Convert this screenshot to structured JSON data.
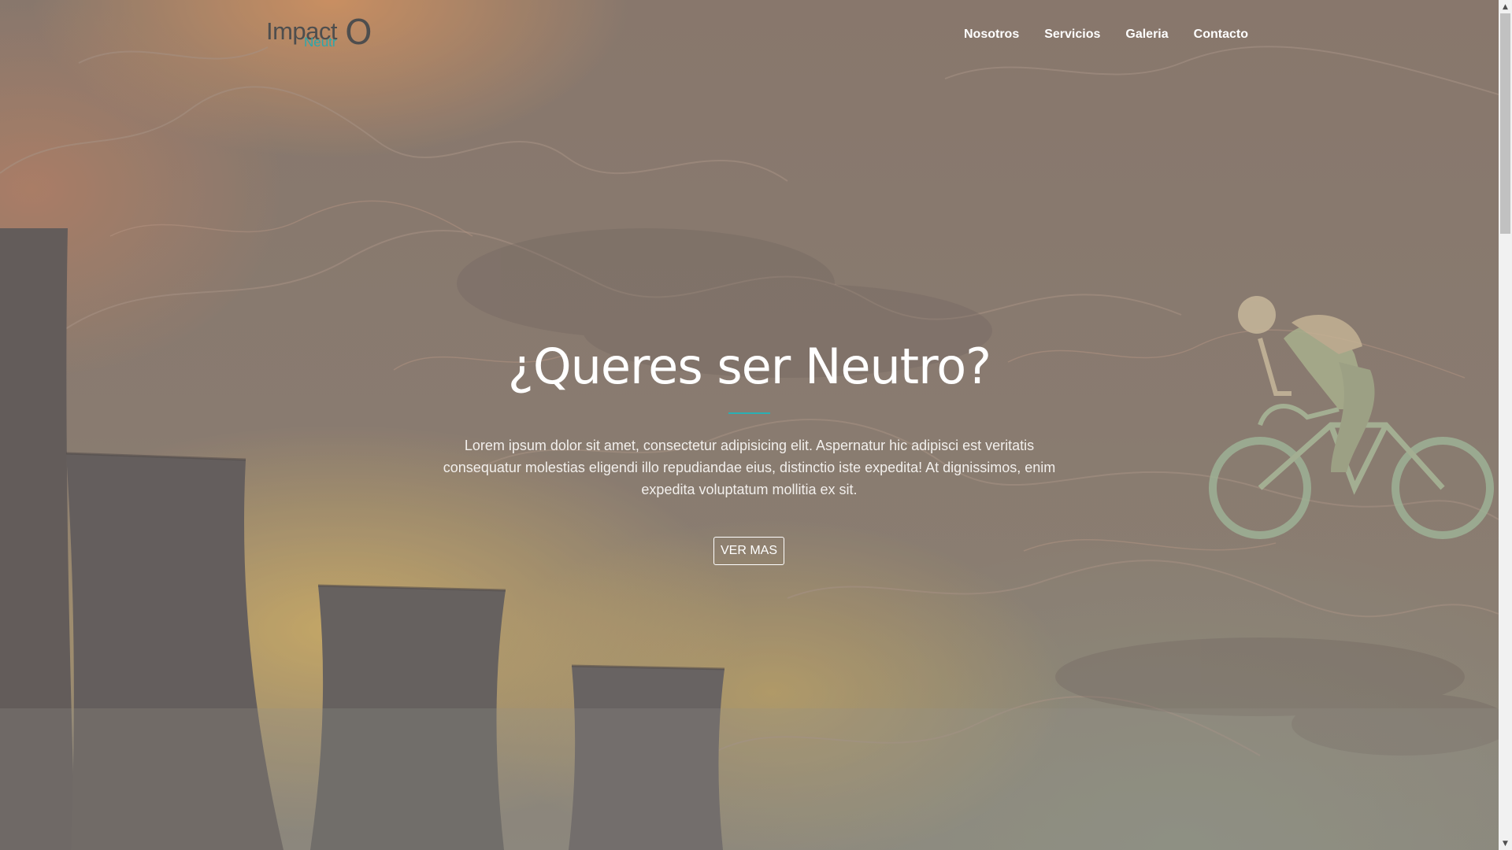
{
  "header": {
    "logo": {
      "word": "Impact",
      "letter": "O",
      "sub": "Neutr"
    },
    "nav": [
      {
        "label": "Nosotros"
      },
      {
        "label": "Servicios"
      },
      {
        "label": "Galeria"
      },
      {
        "label": "Contacto"
      }
    ]
  },
  "hero": {
    "title": "¿Queres ser Neutro?",
    "text": "Lorem ipsum dolor sit amet, consectetur adipisicing elit. Aspernatur hic adipisci est veritatis consequatur molestias eligendi illo repudiandae eius, distinctio iste expedita! At dignissimos, enim expedita voluptatum mollitia ex sit.",
    "button_label": "VER MAS"
  },
  "scrollbar": {
    "up_icon": "chevron-up-icon",
    "down_icon": "chevron-down-icon"
  },
  "colors": {
    "accent": "#2ab0b4",
    "logo_gray": "#4e4e4e",
    "logo_teal": "#2aa8ac"
  }
}
